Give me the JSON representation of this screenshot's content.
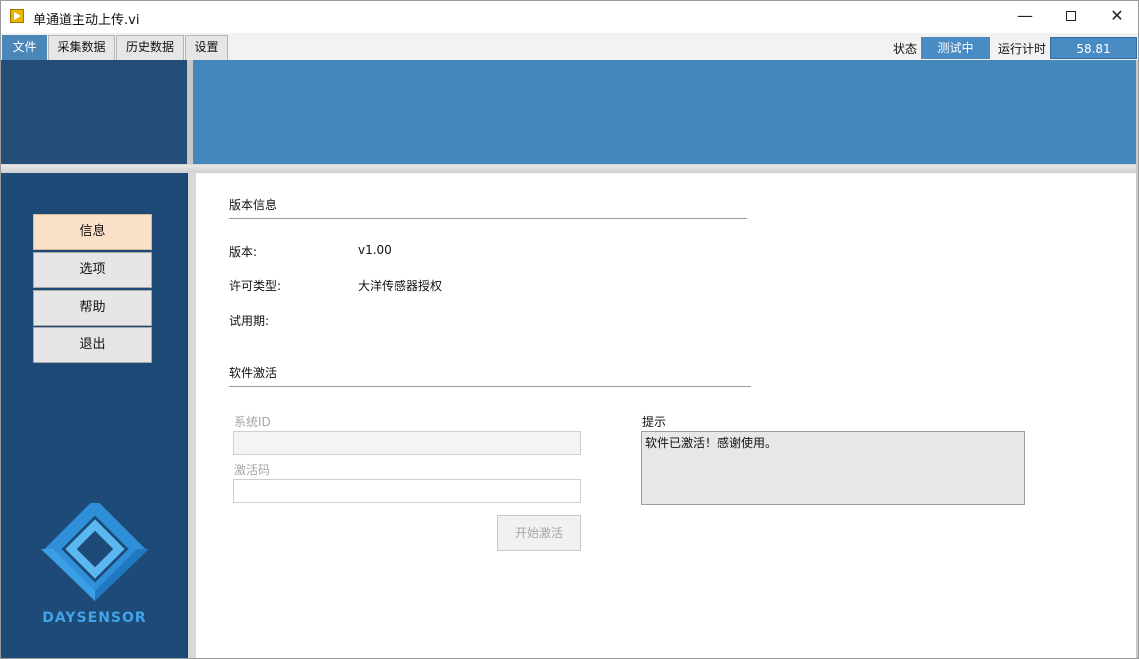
{
  "window": {
    "title": "单通道主动上传.vi"
  },
  "menu": {
    "tabs": [
      {
        "label": "文件"
      },
      {
        "label": "采集数据"
      },
      {
        "label": "历史数据"
      },
      {
        "label": "设置"
      }
    ],
    "status_label": "状态",
    "status_value": "测试中",
    "timer_label": "运行计时",
    "timer_value": "58.81"
  },
  "sidebar": {
    "items": [
      {
        "label": "信息"
      },
      {
        "label": "选项"
      },
      {
        "label": "帮助"
      },
      {
        "label": "退出"
      }
    ],
    "logo_text": "DAYSENSOR"
  },
  "version_section": {
    "title": "版本信息",
    "version_label": "版本:",
    "version_value": "v1.00",
    "license_label": "许可类型:",
    "license_value": "大洋传感器授权",
    "trial_label": "试用期:",
    "trial_value": ""
  },
  "activation_section": {
    "title": "软件激活",
    "system_id_label": "系统ID",
    "system_id_value": "",
    "code_label": "激活码",
    "code_value": "",
    "activate_button": "开始激活",
    "hint_label": "提示",
    "hint_text": "软件已激活！感谢使用。"
  },
  "colors": {
    "menu_active": "#4b86b8",
    "header_left": "#244d78",
    "header_right": "#4488bb",
    "sidebar": "#1e4a78",
    "sidebar_active": "#fbe1c8",
    "logo": "#3fa4e8"
  }
}
